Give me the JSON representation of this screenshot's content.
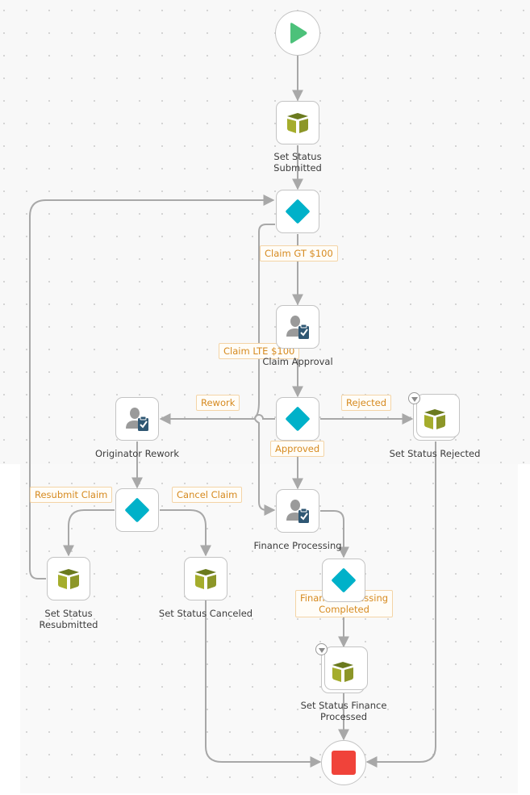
{
  "workflow": {
    "start": {
      "icon": "play-icon",
      "color": "#4cc17a"
    },
    "end": {
      "icon": "stop-icon",
      "color": "#f0433a"
    },
    "nodes": {
      "set_status_submitted": {
        "label_line1": "Set Status",
        "label_line2": "Submitted",
        "icon": "cube-icon"
      },
      "decision_claim_amount": {
        "icon": "diamond-icon"
      },
      "claim_approval": {
        "label": "Claim Approval",
        "icon": "user-task-icon"
      },
      "decision_approval": {
        "icon": "diamond-icon"
      },
      "originator_rework": {
        "label": "Originator Rework",
        "icon": "user-task-icon"
      },
      "set_status_rejected": {
        "label": "Set Status Rejected",
        "icon": "cube-icon"
      },
      "decision_rework": {
        "icon": "diamond-icon"
      },
      "finance_processing": {
        "label": "Finance Processing",
        "icon": "user-task-icon"
      },
      "set_status_resubmitted": {
        "label_line1": "Set Status",
        "label_line2": "Resubmitted",
        "icon": "cube-icon"
      },
      "set_status_canceled": {
        "label": "Set Status Canceled",
        "icon": "cube-icon"
      },
      "decision_finance": {
        "icon": "diamond-icon"
      },
      "set_status_finance_processed": {
        "label_line1": "Set Status Finance",
        "label_line2": "Processed",
        "icon": "cube-icon"
      }
    },
    "conditions": {
      "claim_gt": "Claim GT $100",
      "claim_lte": "Claim LTE $100",
      "rework": "Rework",
      "rejected": "Rejected",
      "approved": "Approved",
      "resubmit_claim": "Resubmit Claim",
      "cancel_claim": "Cancel Claim",
      "finance_completed_line1": "Finance Processing",
      "finance_completed_line2": "Completed"
    },
    "colors": {
      "decision": "#00b1c9",
      "cube_top": "#6b7a1e",
      "cube_left": "#a5ad2c",
      "cube_right": "#8c9628",
      "user": "#9a9a9a",
      "clipboard": "#2f5773",
      "edge": "#a8a8a8",
      "condition_text": "#d68a1f"
    }
  }
}
